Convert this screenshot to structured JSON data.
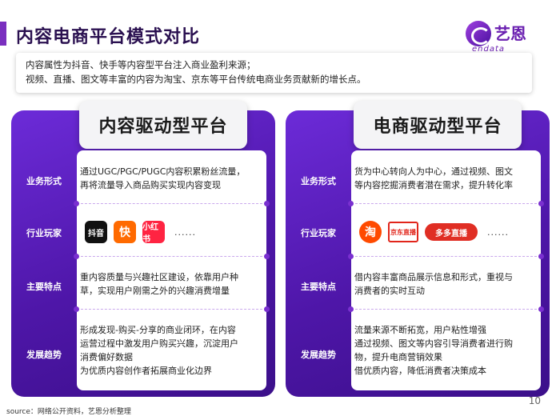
{
  "header": {
    "title": "内容电商平台模式对比"
  },
  "logo": {
    "cn": "艺恩",
    "en": "endata"
  },
  "intro": {
    "line1": "内容属性为抖音、快手等内容型平台注入商业盈利来源；",
    "line2": "视频、直播、图文等丰富的内容为淘宝、京东等平台传统电商业务贡献新的增长点。"
  },
  "left_card": {
    "title": "内容驱动型平台",
    "labels": [
      "业务形式",
      "行业玩家",
      "主要特点",
      "发展趋势"
    ],
    "business": [
      "通过UGC/PGC/PUGC内容积累粉丝流量，",
      "再将流量导入商品购买实现内容变现"
    ],
    "players": [
      {
        "icon": "douyin-icon",
        "text": "抖音"
      },
      {
        "icon": "kuaishou-icon",
        "text": "快"
      },
      {
        "icon": "xiaohongshu-icon",
        "text": "小红书"
      }
    ],
    "players_more": "......",
    "features": [
      "重内容质量与兴趣社区建设，依靠用户种",
      "草，实现用户刚需之外的兴趣消费增量"
    ],
    "trends": [
      "形成发现-购买-分享的商业闭环，在内容",
      "运营过程中激发用户购买兴趣，沉淀用户",
      "消费偏好数据",
      "为优质内容创作者拓展商业化边界"
    ]
  },
  "right_card": {
    "title": "电商驱动型平台",
    "labels": [
      "业务形式",
      "行业玩家",
      "主要特点",
      "发展趋势"
    ],
    "business": [
      "货为中心转向人为中心，通过视频、图文",
      "等内容挖掘消费者潜在需求，提升转化率"
    ],
    "players": [
      {
        "icon": "taobao-live-icon",
        "text": "淘"
      },
      {
        "icon": "jd-live-icon",
        "text": "京东直播"
      },
      {
        "icon": "pdd-live-icon",
        "text": "多多直播"
      }
    ],
    "players_more": "......",
    "features": [
      "借内容丰富商品展示信息和形式，重视与",
      "消费者的实时互动"
    ],
    "trends": [
      "流量来源不断拓宽，用户粘性增强",
      "通过视频、图文等内容引导消费者进行购",
      "物，提升电商营销效果",
      "借优质内容，降低消费者决策成本"
    ]
  },
  "footer": {
    "source": "source：网络公开资料，艺恩分析整理",
    "page": "10"
  },
  "colors": {
    "accent": "#7a2fbf",
    "card_dark": "#3b0f8a",
    "card_light": "#6c2bd8"
  }
}
